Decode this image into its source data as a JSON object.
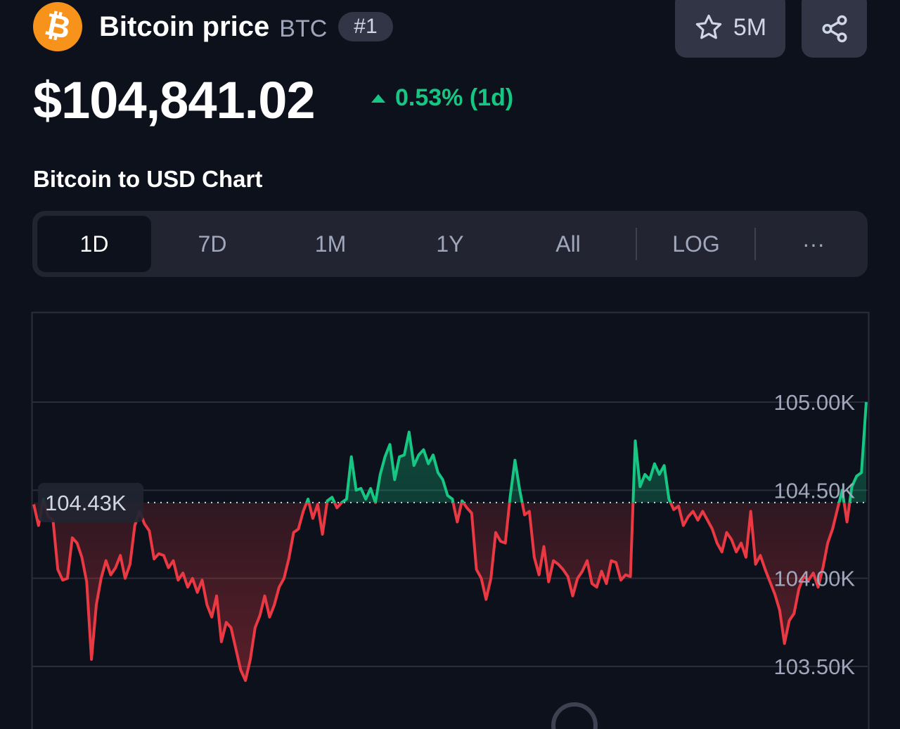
{
  "coin": {
    "name": "Bitcoin price",
    "symbol": "BTC",
    "rank": "#1",
    "logo_glyph": "₿",
    "logo_color": "#f7931a"
  },
  "actions": {
    "watchlist_count": "5M",
    "watch_icon": "star-icon",
    "share_icon": "share-icon"
  },
  "price": {
    "value": "$104,841.02",
    "change": "0.53% (1d)",
    "change_direction": "up",
    "change_color": "#16c784"
  },
  "chart_section": {
    "title": "Bitcoin to USD Chart",
    "tabs": [
      {
        "label": "1D",
        "active": true
      },
      {
        "label": "7D",
        "active": false
      },
      {
        "label": "1M",
        "active": false
      },
      {
        "label": "1Y",
        "active": false
      },
      {
        "label": "All",
        "active": false
      },
      {
        "label": "LOG",
        "active": false
      },
      {
        "label": "···",
        "active": false
      }
    ]
  },
  "colors": {
    "up": "#16c784",
    "down": "#ea3943",
    "background": "#0c111b",
    "panel": "#222531",
    "button": "#323546"
  },
  "chart_data": {
    "type": "line",
    "title": "",
    "xlabel": "",
    "ylabel": "",
    "ylim": [
      103300,
      105250
    ],
    "y_ticks": [
      105000,
      104500,
      104000,
      103500
    ],
    "y_tick_labels": [
      "105.00K",
      "104.50K",
      "104.00K",
      "103.50K"
    ],
    "baseline": 104430,
    "baseline_label": "104.43K",
    "grid": true,
    "series": [
      {
        "values": [
          104420,
          104300,
          104450,
          104350,
          104330,
          104050,
          103990,
          104000,
          104230,
          104200,
          104120,
          103980,
          103540,
          103850,
          104000,
          104100,
          104020,
          104060,
          104130,
          104000,
          104080,
          104300,
          104380,
          104310,
          104270,
          104110,
          104140,
          104130,
          104060,
          104100,
          103990,
          104030,
          103950,
          104000,
          103920,
          103990,
          103850,
          103780,
          103900,
          103640,
          103750,
          103720,
          103600,
          103480,
          103420,
          103540,
          103720,
          103790,
          103900,
          103780,
          103850,
          103950,
          104000,
          104110,
          104260,
          104280,
          104380,
          104450,
          104340,
          104420,
          104250,
          104440,
          104460,
          104400,
          104430,
          104450,
          104690,
          104500,
          104510,
          104450,
          104510,
          104430,
          104590,
          104690,
          104760,
          104560,
          104690,
          104700,
          104830,
          104640,
          104700,
          104730,
          104650,
          104700,
          104600,
          104560,
          104470,
          104450,
          104320,
          104440,
          104400,
          104370,
          104050,
          104000,
          103880,
          104000,
          104260,
          104210,
          104200,
          104460,
          104670,
          104500,
          104360,
          104380,
          104120,
          104020,
          104180,
          103980,
          104100,
          104080,
          104050,
          104010,
          103900,
          104000,
          104040,
          104100,
          103970,
          103950,
          104040,
          103970,
          104100,
          104090,
          103990,
          104020,
          104010,
          104780,
          104520,
          104590,
          104560,
          104650,
          104590,
          104640,
          104450,
          104390,
          104410,
          104300,
          104350,
          104380,
          104330,
          104380,
          104330,
          104280,
          104200,
          104150,
          104260,
          104220,
          104150,
          104200,
          104120,
          104380,
          104080,
          104130,
          104050,
          103980,
          103910,
          103820,
          103630,
          103760,
          103800,
          103940,
          104010,
          103990,
          104030,
          103950,
          104060,
          104200,
          104280,
          104390,
          104500,
          104320,
          104520,
          104580,
          104600,
          105000
        ]
      }
    ]
  }
}
